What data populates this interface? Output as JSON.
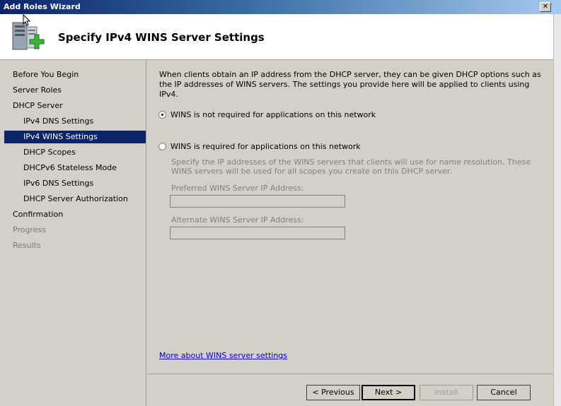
{
  "window": {
    "title": "Add Roles Wizard",
    "close_glyph": "✕"
  },
  "header": {
    "title": "Specify IPv4 WINS Server Settings",
    "icon": "server-add-icon"
  },
  "nav": {
    "items": [
      {
        "label": "Before You Begin"
      },
      {
        "label": "Server Roles"
      },
      {
        "label": "DHCP Server"
      },
      {
        "label": "IPv4 DNS Settings"
      },
      {
        "label": "IPv4 WINS Settings"
      },
      {
        "label": "DHCP Scopes"
      },
      {
        "label": "DHCPv6 Stateless Mode"
      },
      {
        "label": "IPv6 DNS Settings"
      },
      {
        "label": "DHCP Server Authorization"
      },
      {
        "label": "Confirmation"
      },
      {
        "label": "Progress"
      },
      {
        "label": "Results"
      }
    ]
  },
  "content": {
    "intro": "When clients obtain an IP address from the DHCP server, they can be given DHCP options such as the IP addresses of WINS servers. The settings you provide here will be applied to clients using IPv4.",
    "option_not_required": "WINS is not required for applications on this network",
    "option_required": "WINS is required for applications on this network",
    "required_description": "Specify the IP addresses of the WINS servers that clients will use for name resolution. These WINS servers will be used for all scopes you create on this DHCP server.",
    "preferred_label": "Preferred WINS Server IP Address:",
    "preferred_value": "",
    "alternate_label": "Alternate WINS Server IP Address:",
    "alternate_value": "",
    "more_link": "More about WINS server settings"
  },
  "buttons": {
    "previous": "< Previous",
    "next": "Next >",
    "install": "Install",
    "cancel": "Cancel"
  },
  "colors": {
    "selection": "#0a246a",
    "link": "#0000cc",
    "title_bar": "#0a246a"
  }
}
